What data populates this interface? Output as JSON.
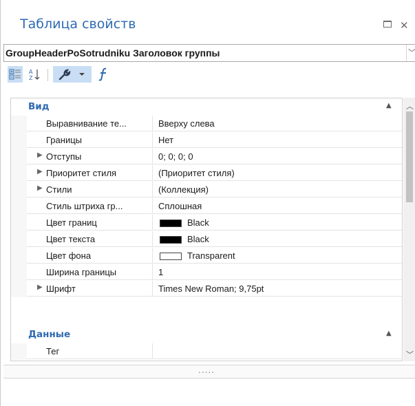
{
  "panel": {
    "title": "Таблица свойств"
  },
  "selector": {
    "text": "GroupHeaderPoSotrudniku   Заголовок группы"
  },
  "toolbar": {
    "buttons": [
      "categorized-icon",
      "alphabetical-icon",
      "properties-wrench-icon",
      "dropdown-arrow-icon",
      "events-function-icon"
    ]
  },
  "grid": {
    "categories": [
      {
        "label": "Вид",
        "rows": [
          {
            "name": "Выравнивание те...",
            "value": "Вверху слева"
          },
          {
            "name": "Границы",
            "value": "Нет"
          },
          {
            "name": "Отступы",
            "value": "0; 0; 0; 0",
            "expandable": true
          },
          {
            "name": "Приоритет стиля",
            "value": "(Приоритет стиля)",
            "expandable": true
          },
          {
            "name": "Стили",
            "value": "(Коллекция)",
            "expandable": true
          },
          {
            "name": "Стиль штриха гр...",
            "value": "Сплошная"
          },
          {
            "name": "Цвет границ",
            "value": "Black",
            "swatch": "#000000"
          },
          {
            "name": "Цвет текста",
            "value": "Black",
            "swatch": "#000000"
          },
          {
            "name": "Цвет фона",
            "value": "Transparent",
            "swatch": "#ffffff"
          },
          {
            "name": "Ширина границы",
            "value": "1"
          },
          {
            "name": "Шрифт",
            "value": "Times New Roman; 9,75pt",
            "expandable": true
          }
        ]
      },
      {
        "label": "Данные",
        "rows": [
          {
            "name": "Тег",
            "value": ""
          }
        ]
      }
    ]
  },
  "splitter": {
    "grip": "....."
  },
  "colors": {
    "accent": "#2e6ab1",
    "toolbar_active": "#c9def5"
  }
}
